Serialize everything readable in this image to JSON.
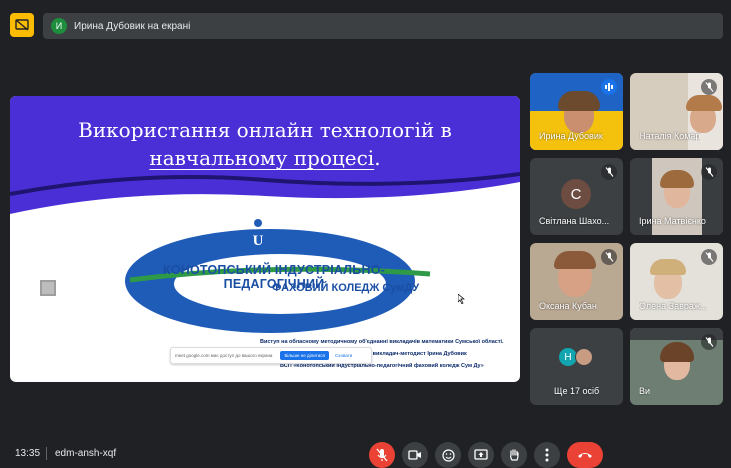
{
  "banner": {
    "avatar_letter": "И",
    "text": "Ирина Дубовик на екрані"
  },
  "slide": {
    "title_line1": "Використання онлайн технологій в",
    "title_line2": "навчальному процесі",
    "title_dot": ".",
    "college_line1": "КОНОТОПСЬКИЙ ІНДУСТРІАЛЬНО-ПЕДАГОГІЧНИЙ",
    "college_line2": "ФАХОВИЙ КОЛЕДЖ СумДУ",
    "footer_line1": "Виступ на обласному методичному об'єднанні викладачів математики Сумської області.",
    "footer_line2": "категорії, викладач-методист Ірина Дубовик",
    "footer_line3": "ВСП «Конотопський індустріально-педагогічний фаховий коледж Сум Ду»",
    "popup_text": "meet.google.com має доступ до вашого екрана",
    "popup_button": "Більше не ділитися",
    "popup_link": "Сховати",
    "colors": {
      "banner_purple": "#4a2fd6",
      "logo_blue": "#1a4ea3",
      "logo_green": "#2e9a48"
    }
  },
  "participants": [
    {
      "name": "Ирина Дубовик",
      "state": "speaking"
    },
    {
      "name": "Наталія Комар",
      "state": "muted"
    },
    {
      "name": "Світлана Шахо...",
      "state": "muted",
      "avatar_letter": "С"
    },
    {
      "name": "Ірина Матвієнко",
      "state": "muted"
    },
    {
      "name": "Оксана Кубан",
      "state": "muted"
    },
    {
      "name": "Олена Завраж...",
      "state": "muted"
    },
    {
      "name": "Ще 17 осіб",
      "avatar_letter": "Н"
    },
    {
      "name": "Ви",
      "state": "muted"
    }
  ],
  "bottom": {
    "time": "13:35",
    "meeting_code": "edm-ansh-xqf"
  },
  "controls": [
    "mic-off-icon",
    "camera-icon",
    "emoji-icon",
    "present-icon",
    "raise-hand-icon",
    "more-icon",
    "end-call-icon"
  ]
}
